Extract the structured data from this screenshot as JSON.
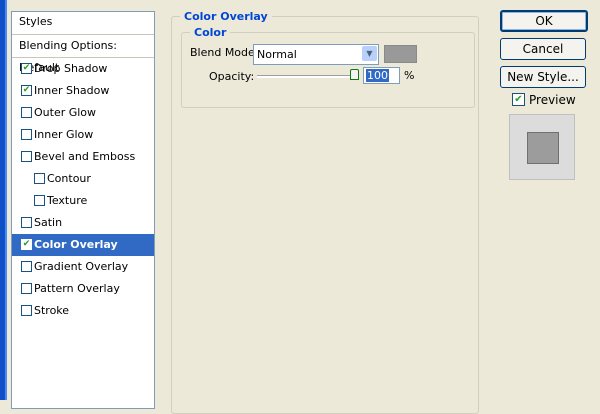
{
  "styles_panel": {
    "header": "Styles",
    "blending_options": "Blending Options: Default",
    "items": [
      {
        "label": "Drop Shadow",
        "checked": "✔"
      },
      {
        "label": "Inner Shadow",
        "checked": "✔"
      },
      {
        "label": "Outer Glow",
        "checked": ""
      },
      {
        "label": "Inner Glow",
        "checked": ""
      },
      {
        "label": "Bevel and Emboss",
        "checked": ""
      },
      {
        "label": "Contour",
        "checked": ""
      },
      {
        "label": "Texture",
        "checked": ""
      },
      {
        "label": "Satin",
        "checked": ""
      },
      {
        "label": "Color Overlay",
        "checked": "✔"
      },
      {
        "label": "Gradient Overlay",
        "checked": ""
      },
      {
        "label": "Pattern Overlay",
        "checked": ""
      },
      {
        "label": "Stroke",
        "checked": ""
      }
    ]
  },
  "color_overlay": {
    "title": "Color Overlay",
    "color_group": "Color",
    "blend_mode_label": "Blend Mode:",
    "blend_mode_value": "Normal",
    "overlay_color": "#999999",
    "opacity_label": "Opacity:",
    "opacity_value": "100",
    "opacity_unit": "%"
  },
  "buttons": {
    "ok": "OK",
    "cancel": "Cancel",
    "new_style": "New Style..."
  },
  "preview": {
    "label": "Preview",
    "checked": "✔"
  },
  "colors": {
    "selection": "#316ac5",
    "heading": "#0046d5"
  }
}
